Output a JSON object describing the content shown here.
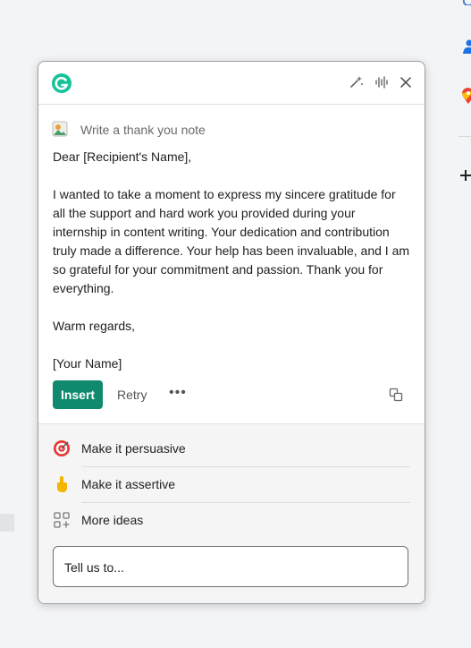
{
  "panel": {
    "header": {
      "logo_icon": "grammarly-logo-icon",
      "actions": [
        "sparkle-icon",
        "voice-icon",
        "close-icon"
      ]
    },
    "prompt": {
      "icon": "image-prompt-icon",
      "text": "Write a thank you note"
    },
    "letter": {
      "greeting": "Dear [Recipient's Name],",
      "body": "I wanted to take a moment to express my sincere gratitude for all the support and hard work you provided during your internship in content writing. Your dedication and contribution truly made a difference. Your help has been invaluable, and I am so grateful for your commitment and passion. Thank you for everything.",
      "closing": "Warm regards,",
      "signature": "[Your Name]"
    },
    "actions": {
      "insert_label": "Insert",
      "retry_label": "Retry",
      "more_label": "•••",
      "copy_icon": "copy-icon"
    },
    "suggestions": [
      {
        "icon": "target-icon",
        "label": "Make it persuasive"
      },
      {
        "icon": "pointing-hand-icon",
        "label": "Make it assertive"
      },
      {
        "icon": "grid-plus-icon",
        "label": "More ideas"
      }
    ],
    "input": {
      "placeholder": "Tell us to..."
    }
  },
  "colors": {
    "accent": "#0f8a6e",
    "logo": "#15c39a",
    "background": "#f3f4f6"
  }
}
